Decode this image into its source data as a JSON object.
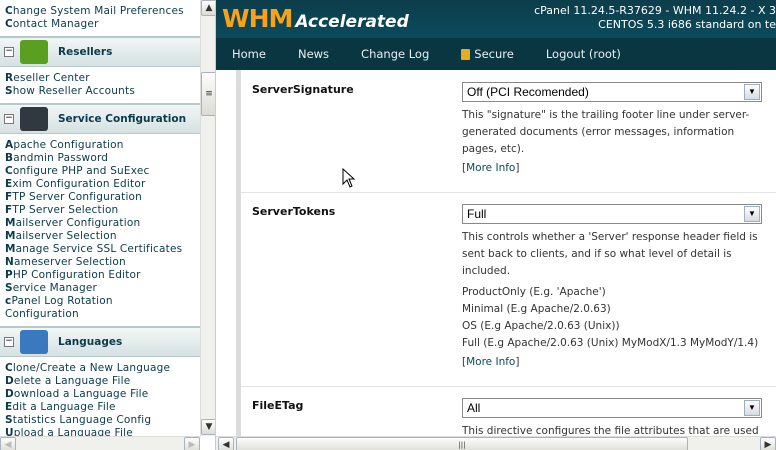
{
  "sidebar": {
    "top_links": [
      [
        "C",
        "hange System Mail Preferences"
      ],
      [
        "C",
        "ontact Manager"
      ]
    ],
    "sections": [
      {
        "title": "Resellers",
        "icon": "money-icon",
        "color": "#5aa020",
        "links": [
          [
            "R",
            "eseller Center"
          ],
          [
            "S",
            "how Reseller Accounts"
          ]
        ]
      },
      {
        "title": "Service Configuration",
        "icon": "server-gear-icon",
        "color": "#303840",
        "links": [
          [
            "A",
            "pache Configuration"
          ],
          [
            "B",
            "andmin Password"
          ],
          [
            "C",
            "onfigure PHP and SuExec"
          ],
          [
            "E",
            "xim Configuration Editor"
          ],
          [
            "F",
            "TP Server Configuration"
          ],
          [
            "F",
            "TP Server Selection"
          ],
          [
            "M",
            "ailserver Configuration"
          ],
          [
            "M",
            "ailserver Selection"
          ],
          [
            "M",
            "anage Service SSL Certificates"
          ],
          [
            "N",
            "ameserver Selection"
          ],
          [
            "P",
            "HP Configuration Editor"
          ],
          [
            "S",
            "ervice Manager"
          ],
          [
            "c",
            "Panel Log Rotation"
          ],
          [
            "",
            "Configuration"
          ]
        ]
      },
      {
        "title": "Languages",
        "icon": "language-icon",
        "color": "#3a78c0",
        "links": [
          [
            "C",
            "lone/Create a New Language"
          ],
          [
            "D",
            "elete a Language File"
          ],
          [
            "D",
            "ownload a Language File"
          ],
          [
            "E",
            "dit a Language File"
          ],
          [
            "S",
            "tatistics Language Config"
          ],
          [
            "U",
            "pload a Language File"
          ]
        ]
      }
    ]
  },
  "header": {
    "logo_main": "WHM",
    "logo_sub": "Accelerated",
    "version_line1": "cPanel 11.24.5-R37629 - WHM 11.24.2 - X 3",
    "version_line2": "CENTOS 5.3 i686 standard on te"
  },
  "nav": [
    "Home",
    "News",
    "Change Log",
    "Secure",
    "Logout (root)"
  ],
  "settings": [
    {
      "label": "ServerSignature",
      "value": "Off (PCI Recomended)",
      "desc": [
        "This \"signature\" is the trailing footer line under server-",
        "generated documents (error messages, information",
        "pages, etc)."
      ],
      "options": [],
      "more": "More Info"
    },
    {
      "label": "ServerTokens",
      "value": "Full",
      "desc": [
        "This controls whether a 'Server' response header field is",
        "sent back to clients, and if so what level of detail is",
        "included."
      ],
      "options": [
        "ProductOnly (E.g. 'Apache')",
        "Minimal (E.g Apache/2.0.63)",
        "OS (E.g Apache/2.0.63 (Unix))",
        "Full (E.g Apache/2.0.63 (Unix) MyModX/1.3 MyModY/1.4)"
      ],
      "more": "More Info"
    },
    {
      "label": "FileETag",
      "value": "All",
      "desc": [
        "This directive configures the file attributes that are used"
      ],
      "options": [],
      "more": ""
    }
  ]
}
